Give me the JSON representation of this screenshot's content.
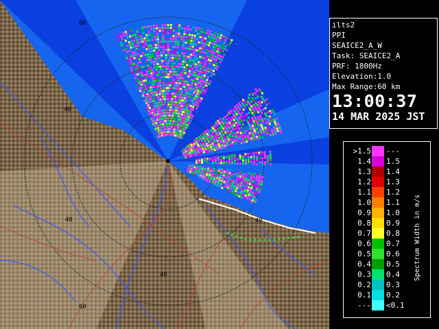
{
  "info": {
    "site": "ilts2",
    "product": "PPI",
    "scan_name": "SEAICE2_A_W",
    "task": "Task: SEAICE2_A",
    "prf": "PRF: 1800Hz",
    "elevation": "Elevation:1.0",
    "max_range": "Max Range:60 km",
    "time": "13:00:37",
    "date": "14 MAR 2025 JST"
  },
  "ring_labels": {
    "outer_top": "60",
    "inner_left": "40",
    "inner_right": "40",
    "left_mid": "40",
    "bottom_40": "40",
    "bottom_60": "60"
  },
  "legend": {
    "title": "Spectrum Width in m/s",
    "rows": [
      {
        "left": ">1.5",
        "right": "---",
        "color": "#ff33ff"
      },
      {
        "left": "1.4",
        "right": "1.5",
        "color": "#d900d9"
      },
      {
        "left": "1.3",
        "right": "1.4",
        "color": "#b00000"
      },
      {
        "left": "1.2",
        "right": "1.3",
        "color": "#e00000"
      },
      {
        "left": "1.1",
        "right": "1.2",
        "color": "#ff4000"
      },
      {
        "left": "1.0",
        "right": "1.1",
        "color": "#ff7f00"
      },
      {
        "left": "0.9",
        "right": "1.0",
        "color": "#ffb000"
      },
      {
        "left": "0.8",
        "right": "0.9",
        "color": "#ffe000"
      },
      {
        "left": "0.7",
        "right": "0.8",
        "color": "#ffff30"
      },
      {
        "left": "0.6",
        "right": "0.7",
        "color": "#00c000"
      },
      {
        "left": "0.5",
        "right": "0.6",
        "color": "#30e030"
      },
      {
        "left": "0.4",
        "right": "0.5",
        "color": "#00a000"
      },
      {
        "left": "0.3",
        "right": "0.4",
        "color": "#00e070"
      },
      {
        "left": "0.2",
        "right": "0.3",
        "color": "#00c0c0"
      },
      {
        "left": "0.1",
        "right": "0.2",
        "color": "#00e0e0"
      },
      {
        "left": "---",
        "right": "<0.1",
        "color": "#40ffff"
      }
    ]
  },
  "colors": {
    "sea": "#1565ee",
    "sea_sector": "#0a3fe0",
    "land": "#7a6448",
    "range_ring": "#202020",
    "river": "#3a58ff",
    "road": "#c04040"
  }
}
